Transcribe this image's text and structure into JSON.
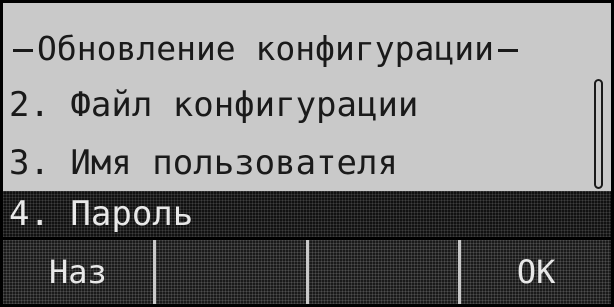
{
  "screen": {
    "title": "Обновление конфигурации",
    "items": [
      {
        "label": "2. Файл конфигурации"
      },
      {
        "label": "3. Имя пользователя"
      },
      {
        "label": "4. Пароль",
        "selected": true
      }
    ],
    "softkeys": [
      {
        "label": "Наз"
      },
      {
        "label": ""
      },
      {
        "label": ""
      },
      {
        "label": "ОК"
      }
    ]
  },
  "colors": {
    "lcd_background": "#c9c9c9",
    "text": "#1a1a1a",
    "highlight": "#111111"
  }
}
